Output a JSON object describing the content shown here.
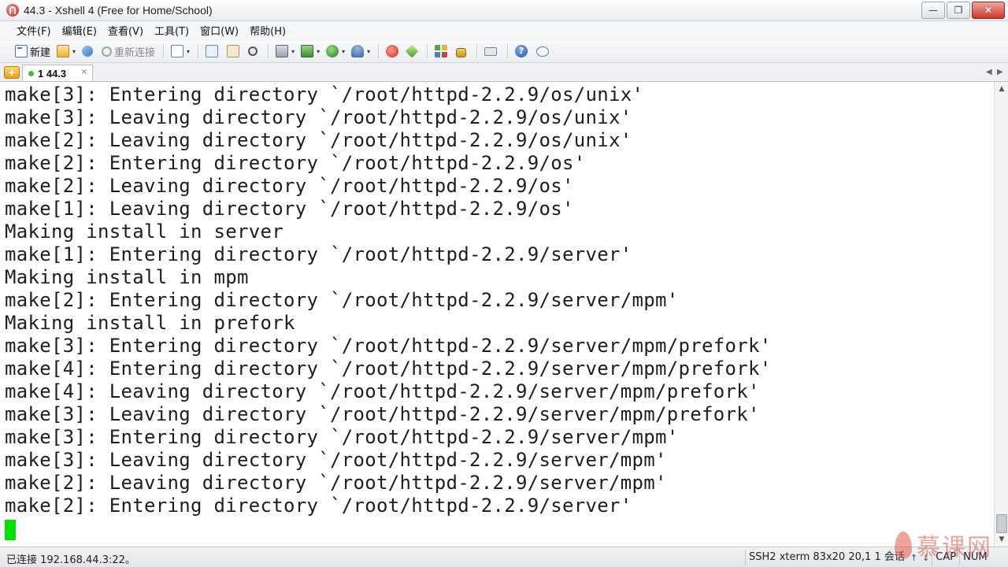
{
  "window": {
    "title": "44.3 - Xshell 4 (Free for Home/School)"
  },
  "title_buttons": {
    "minimize": "—",
    "maximize": "❐",
    "close": "✕"
  },
  "menu": [
    {
      "label": "文件(F)"
    },
    {
      "label": "编辑(E)"
    },
    {
      "label": "查看(V)"
    },
    {
      "label": "工具(T)"
    },
    {
      "label": "窗口(W)"
    },
    {
      "label": "帮助(H)"
    }
  ],
  "toolbar": {
    "new_label": "新建",
    "reconnect_label": "重新连接",
    "help_glyph": "?"
  },
  "tabs": {
    "add_glyph": "+",
    "active": {
      "label": "1 44.3",
      "close": "×"
    },
    "nav_left": "◀",
    "nav_right": "▶"
  },
  "terminal": {
    "lines": [
      "make[3]: Entering directory `/root/httpd-2.2.9/os/unix'",
      "make[3]: Leaving directory `/root/httpd-2.2.9/os/unix'",
      "make[2]: Leaving directory `/root/httpd-2.2.9/os/unix'",
      "make[2]: Entering directory `/root/httpd-2.2.9/os'",
      "make[2]: Leaving directory `/root/httpd-2.2.9/os'",
      "make[1]: Leaving directory `/root/httpd-2.2.9/os'",
      "Making install in server",
      "make[1]: Entering directory `/root/httpd-2.2.9/server'",
      "Making install in mpm",
      "make[2]: Entering directory `/root/httpd-2.2.9/server/mpm'",
      "Making install in prefork",
      "make[3]: Entering directory `/root/httpd-2.2.9/server/mpm/prefork'",
      "make[4]: Entering directory `/root/httpd-2.2.9/server/mpm/prefork'",
      "make[4]: Leaving directory `/root/httpd-2.2.9/server/mpm/prefork'",
      "make[3]: Leaving directory `/root/httpd-2.2.9/server/mpm/prefork'",
      "make[3]: Entering directory `/root/httpd-2.2.9/server/mpm'",
      "make[3]: Leaving directory `/root/httpd-2.2.9/server/mpm'",
      "make[2]: Leaving directory `/root/httpd-2.2.9/server/mpm'",
      "make[2]: Entering directory `/root/httpd-2.2.9/server'"
    ],
    "cursor_color": "#00e000"
  },
  "scrollbar": {
    "up": "▲",
    "down": "▼"
  },
  "status": {
    "connection": "已连接 192.168.44.3:22。",
    "protocol": "SSH2",
    "terminal_type": "xterm",
    "size": "83x20",
    "cursor_pos": "20,1",
    "sessions": "1 会话",
    "up_arrow": "↑",
    "down_arrow": "↓",
    "caps": "CAP",
    "num": "NUM"
  },
  "watermark": {
    "text": "慕课网"
  }
}
